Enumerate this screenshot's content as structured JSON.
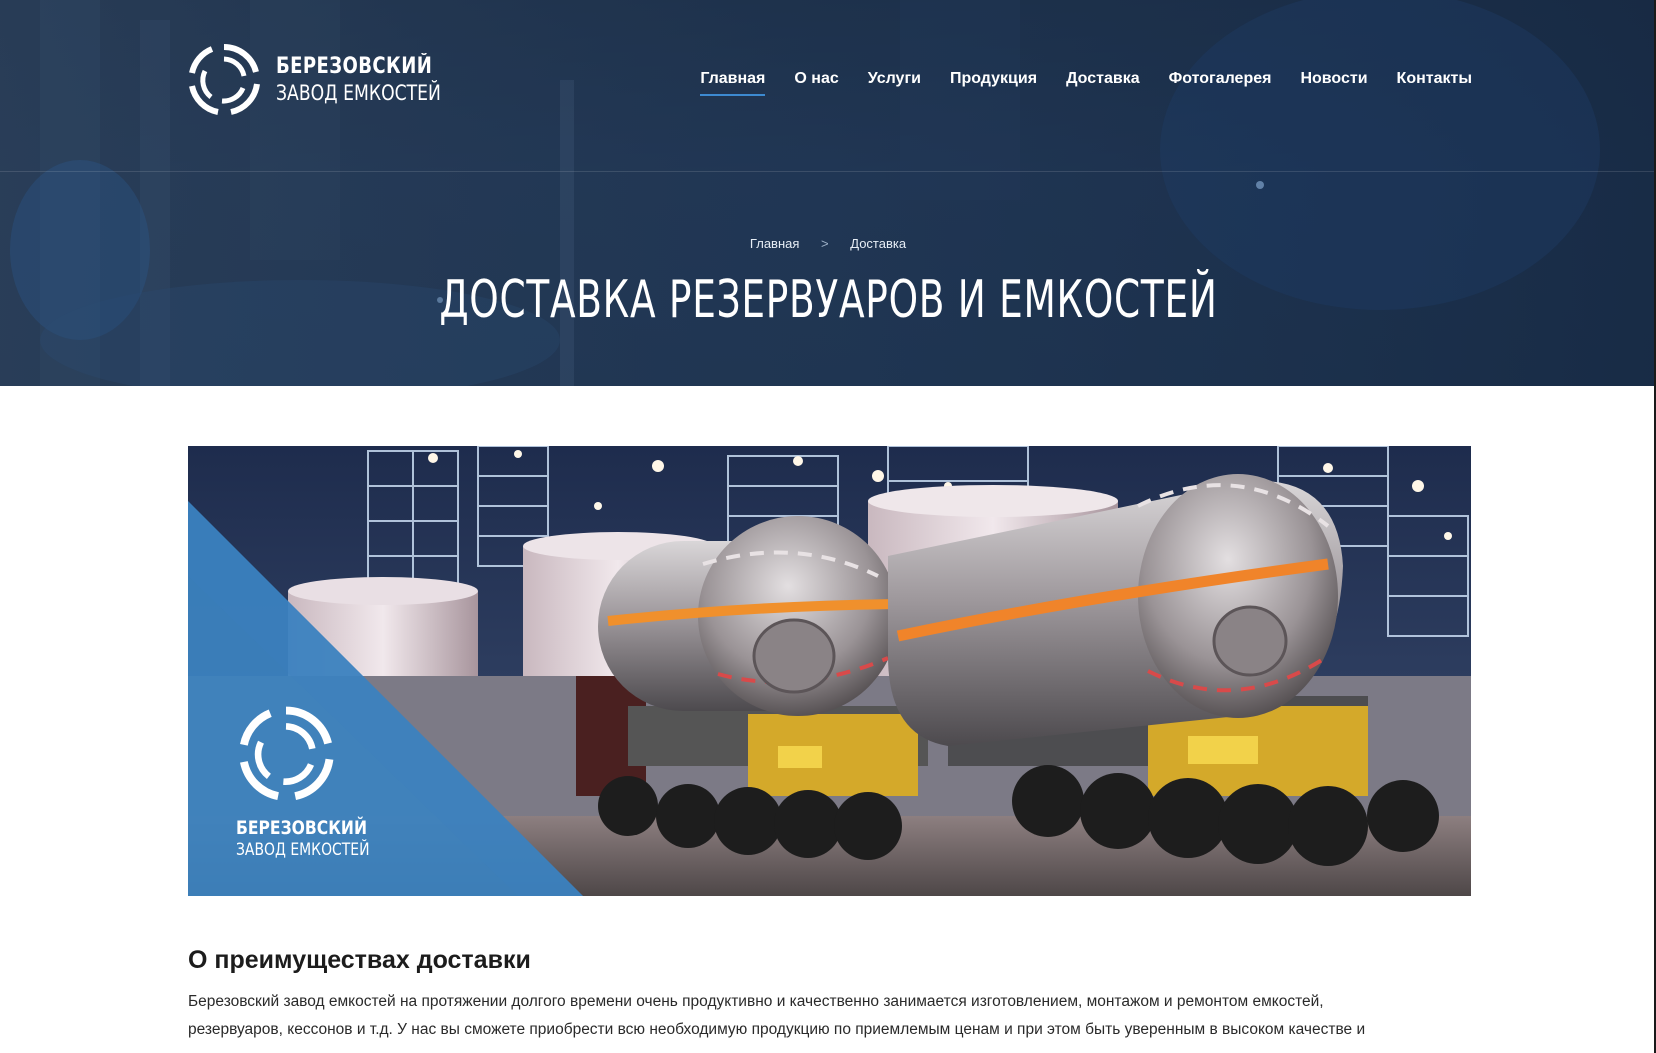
{
  "logo": {
    "line1": "БЕРЕЗОВСКИЙ",
    "line2": "ЗАВОД ЕМКОСТЕЙ"
  },
  "nav": {
    "items": [
      {
        "label": "Главная",
        "active": true
      },
      {
        "label": "О нас",
        "active": false
      },
      {
        "label": "Услуги",
        "active": false
      },
      {
        "label": "Продукция",
        "active": false
      },
      {
        "label": "Доставка",
        "active": false
      },
      {
        "label": "Фотогалерея",
        "active": false
      },
      {
        "label": "Новости",
        "active": false
      },
      {
        "label": "Контакты",
        "active": false
      }
    ]
  },
  "breadcrumb": {
    "home": "Главная",
    "separator": ">",
    "current": "Доставка"
  },
  "page": {
    "title": "ДОСТАВКА РЕЗЕРВУАРОВ И ЕМКОСТЕЙ"
  },
  "banner": {
    "logo_line1": "БЕРЕЗОВСКИЙ",
    "logo_line2": "ЗАВОД ЕМКОСТЕЙ"
  },
  "content": {
    "section_title": "О преимуществах доставки",
    "paragraph_line1": "Березовский завод емкостей на протяжении долгого времени очень продуктивно и качественно занимается изготовлением, монтажом и ремонтом емкостей,",
    "paragraph_line2": "резервуаров, кессонов и т.д. У нас вы сможете приобрести всю необходимую продукцию по приемлемым ценам и при этом быть уверенным в высоком качестве и"
  },
  "colors": {
    "accent": "#3d8ad1",
    "hero_bg": "#22395a",
    "banner_blue": "#3b82c0",
    "tank_stripe": "#e87a22"
  },
  "icons": [
    "brand-ring-icon",
    "breadcrumb-chevron-icon"
  ]
}
